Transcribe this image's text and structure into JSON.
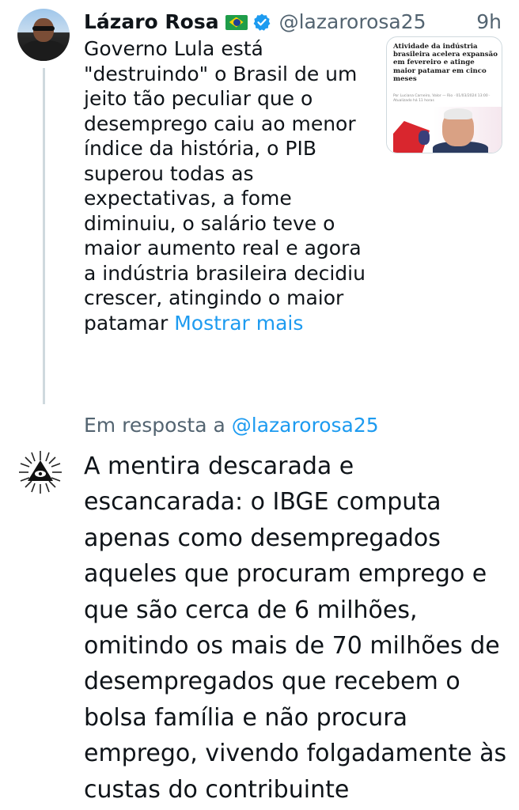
{
  "tweet": {
    "author_name": "Lázaro Rosa",
    "handle": "@lazarorosa25",
    "time": "9h",
    "text": "Governo Lula está \"destruindo\" o Brasil de um jeito tão peculiar que o desemprego caiu ao menor índice da história, o PIB superou todas as expectativas, a fome diminuiu, o salário teve o maior aumento real e agora a indústria brasileira decidiu crescer, atingindo o maior patamar",
    "show_more_label": "Mostrar mais",
    "icons": {
      "flag": "brazil-flag-icon",
      "verified": "verified-badge-icon"
    },
    "media": {
      "headline": "Atividade da indústria brasileira acelera expansão em fevereiro e atinge maior patamar em cinco meses",
      "byline": "Por Luciana Carneiro, Valor — Rio · 01/03/2024 13:00 · Atualizado há 11 horas"
    }
  },
  "reply": {
    "in_reply_to_label": "Em resposta a",
    "in_reply_to_handle": "@lazarorosa25",
    "text": "A mentira descarada e escancarada: o IBGE computa apenas como desempregados aqueles que procuram emprego e que são cerca de 6 milhões, omitindo os mais de 70 milhões de desempregados que recebem o bolsa família e não procura emprego, vivendo folgadamente às custas do contribuinte"
  },
  "colors": {
    "text": "#0f1419",
    "secondary": "#536471",
    "link": "#1d9bf0",
    "thread_line": "#cfd9de"
  }
}
